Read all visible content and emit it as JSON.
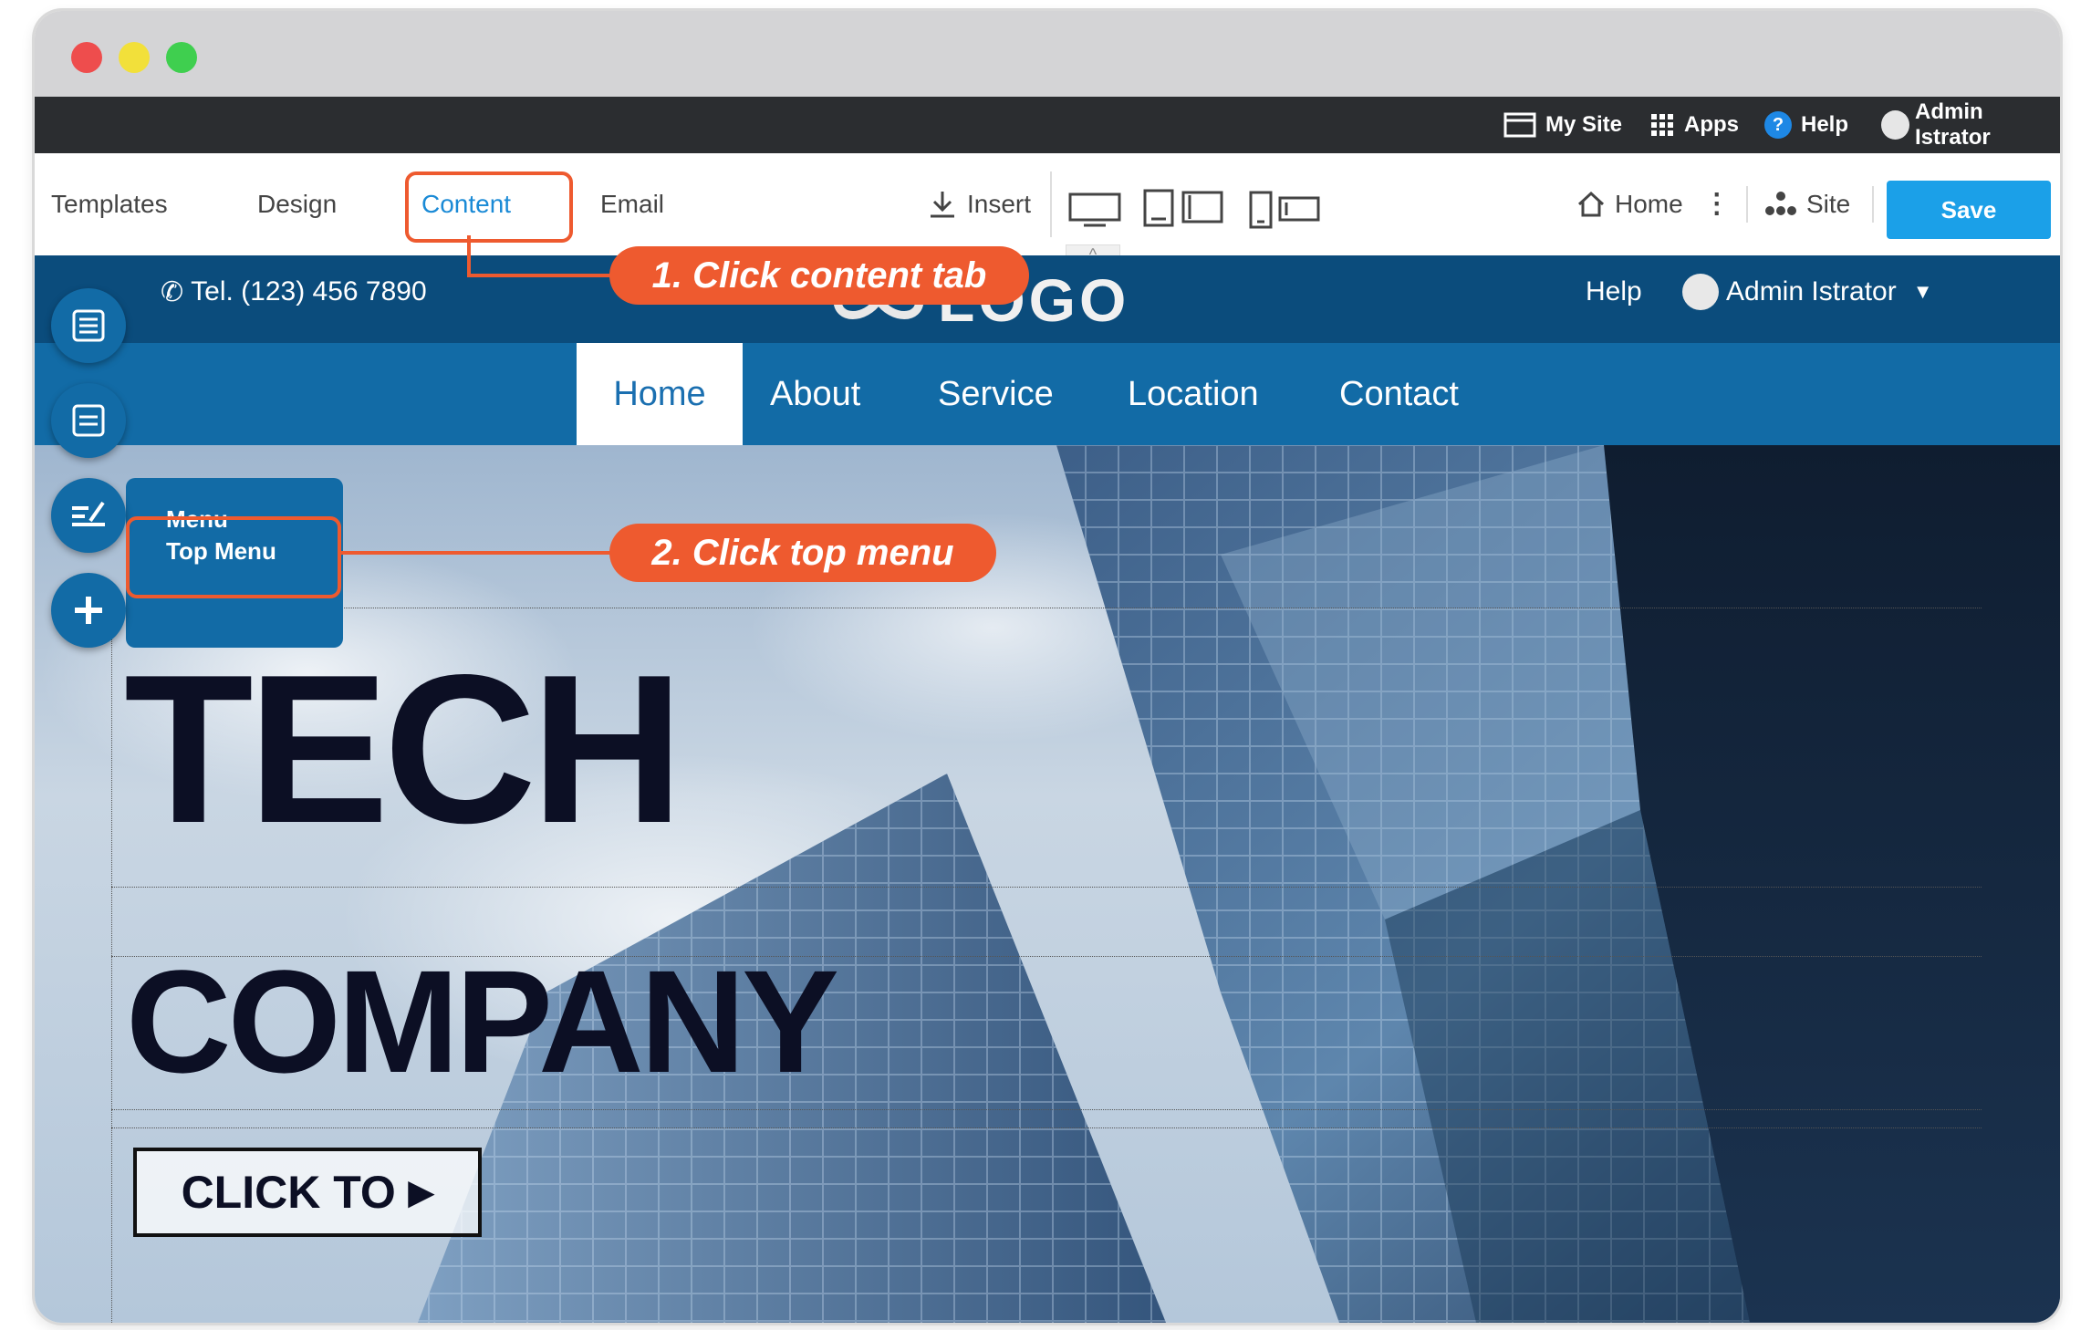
{
  "topbar": {
    "my_site": "My Site",
    "apps": "Apps",
    "help": "Help",
    "user": "Admin Istrator"
  },
  "toolbar": {
    "tabs": [
      "Templates",
      "Design",
      "Content",
      "Email"
    ],
    "active_tab": "Content",
    "insert": "Insert",
    "page": "Home",
    "site": "Site",
    "save": "Save"
  },
  "site_header": {
    "phone": "Tel. (123) 456 7890",
    "logo": "LOGO",
    "help": "Help",
    "user": "Admin Istrator"
  },
  "site_nav": {
    "items": [
      "Home",
      "About",
      "Service",
      "Location",
      "Contact"
    ],
    "active": "Home"
  },
  "hero": {
    "title_line1": "TECH",
    "title_line2": "COMPANY",
    "cta": "CLICK TO"
  },
  "content_menu": {
    "heading": "Menu",
    "item": "Top Menu"
  },
  "annotations": {
    "step1": "1. Click content tab",
    "step2": "2. Click top menu"
  },
  "colors": {
    "accent": "#1ba0e8",
    "header": "#0b4c7c",
    "nav": "#126ba6",
    "callout": "#ee5a2f",
    "topbar": "#2b2d30"
  }
}
